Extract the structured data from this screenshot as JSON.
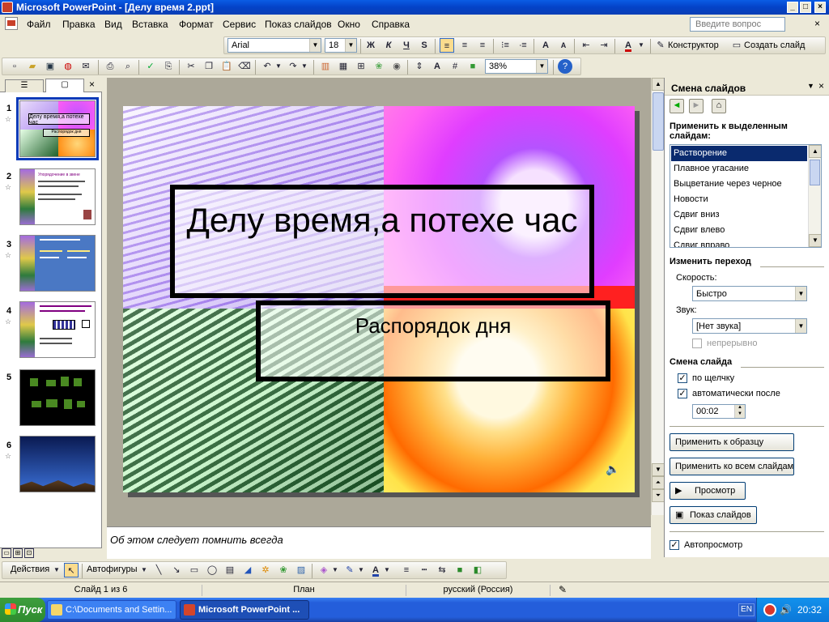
{
  "window": {
    "title": "Microsoft PowerPoint - [Делу время 2.ppt]"
  },
  "menu": {
    "items": [
      "Файл",
      "Правка",
      "Вид",
      "Вставка",
      "Формат",
      "Сервис",
      "Показ слайдов",
      "Окно",
      "Справка"
    ],
    "help_placeholder": "Введите вопрос"
  },
  "format_toolbar": {
    "font": "Arial",
    "size": "18",
    "bold": "Ж",
    "italic": "К",
    "underline": "Ч",
    "shadow": "S",
    "designer": "Конструктор",
    "new_slide": "Создать слайд"
  },
  "standard_toolbar": {
    "zoom": "38%"
  },
  "slides_pane": {
    "thumbnails": [
      {
        "num": "1",
        "title": "Делу время,а потехе час",
        "subtitle": "Распорядок дня"
      },
      {
        "num": "2",
        "title": "Упорядочение в звене"
      },
      {
        "num": "3",
        "title": ""
      },
      {
        "num": "4",
        "title": ""
      },
      {
        "num": "5",
        "title": ""
      },
      {
        "num": "6",
        "title": ""
      }
    ]
  },
  "slide": {
    "title": "Делу время,а потехе час",
    "subtitle": "Распорядок дня"
  },
  "notes": "Об этом следует помнить всегда",
  "task_pane": {
    "title": "Смена слайдов",
    "apply_label": "Применить к выделенным слайдам:",
    "effects": [
      "Растворение",
      "Плавное угасание",
      "Выцветание через черное",
      "Новости",
      "Сдвиг вниз",
      "Сдвиг влево",
      "Сдвиг вправо"
    ],
    "selected_effect": "Растворение",
    "modify_header": "Изменить переход",
    "speed_label": "Скорость:",
    "speed_value": "Быстро",
    "sound_label": "Звук:",
    "sound_value": "[Нет звука]",
    "loop_label": "непрерывно",
    "advance_header": "Смена слайда",
    "on_click_label": "по щелчку",
    "auto_label": "автоматически после",
    "auto_time": "00:02",
    "apply_master": "Применить к образцу",
    "apply_all": "Применить ко всем слайдам",
    "preview": "Просмотр",
    "slideshow": "Показ слайдов",
    "autopreview": "Автопросмотр"
  },
  "draw_toolbar": {
    "actions": "Действия",
    "autoshapes": "Автофигуры"
  },
  "status": {
    "slide": "Слайд 1 из 6",
    "design": "План",
    "language": "русский (Россия)"
  },
  "taskbar": {
    "start": "Пуск",
    "tasks": [
      "C:\\Documents and Settin...",
      "Microsoft PowerPoint ..."
    ],
    "lang": "EN",
    "time": "20:32"
  },
  "colors": {
    "selection": "#0a2a6e",
    "titlebar": "#0a3fb5",
    "taskbar": "#245edb"
  }
}
